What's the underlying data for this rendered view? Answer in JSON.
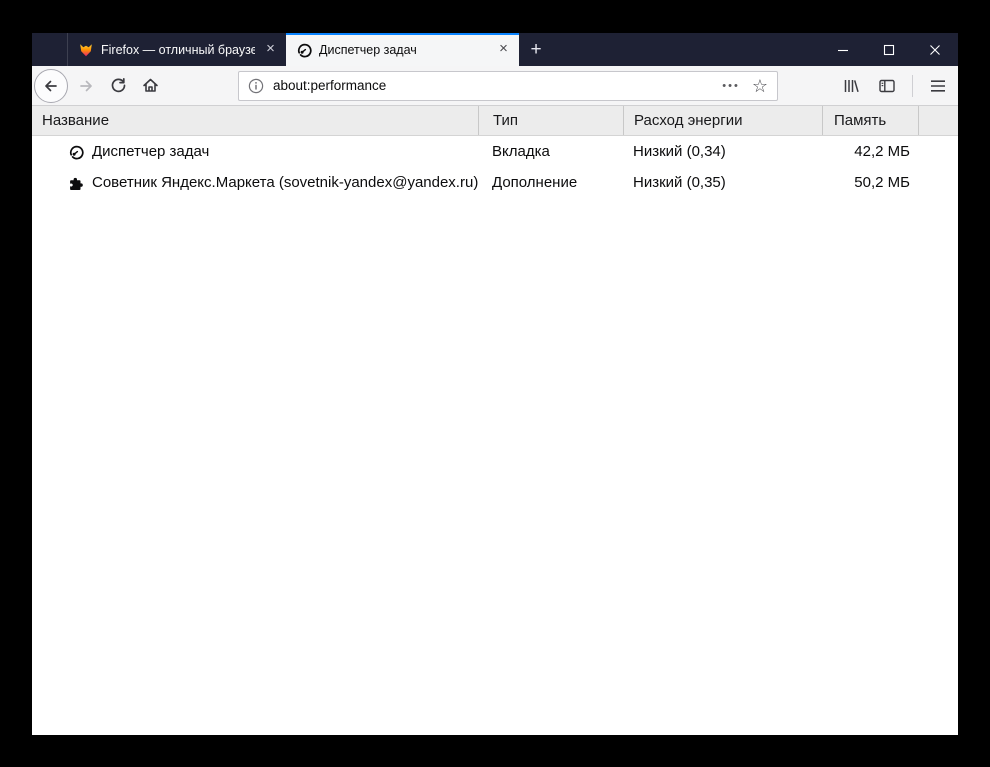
{
  "colors": {
    "titlebar_bg": "#1e2134",
    "active_tab_line": "#0a84ff",
    "toolbar_bg": "#f5f5f6",
    "table_header_bg": "#ececec"
  },
  "tabbar": {
    "tabs": [
      {
        "title": "Firefox — отличный браузер д",
        "icon": "firefox-logo",
        "active": false
      },
      {
        "title": "Диспетчер задач",
        "icon": "performance-gauge",
        "active": true
      }
    ],
    "close_glyph": "×",
    "new_tab_glyph": "+"
  },
  "toolbar": {
    "url": "about:performance",
    "page_actions_glyph": "•••",
    "bookmark_star_glyph": "☆"
  },
  "table": {
    "headers": [
      "Название",
      "Тип",
      "Расход энергии",
      "Память"
    ],
    "rows": [
      {
        "icon": "performance-gauge",
        "name": "Диспетчер задач",
        "type": "Вкладка",
        "energy": "Низкий (0,34)",
        "memory": "42,2 МБ"
      },
      {
        "icon": "puzzle-piece",
        "name": "Советник Яндекс.Маркета (sovetnik-yandex@yandex.ru)",
        "type": "Дополнение",
        "energy": "Низкий (0,35)",
        "memory": "50,2 МБ"
      }
    ]
  }
}
